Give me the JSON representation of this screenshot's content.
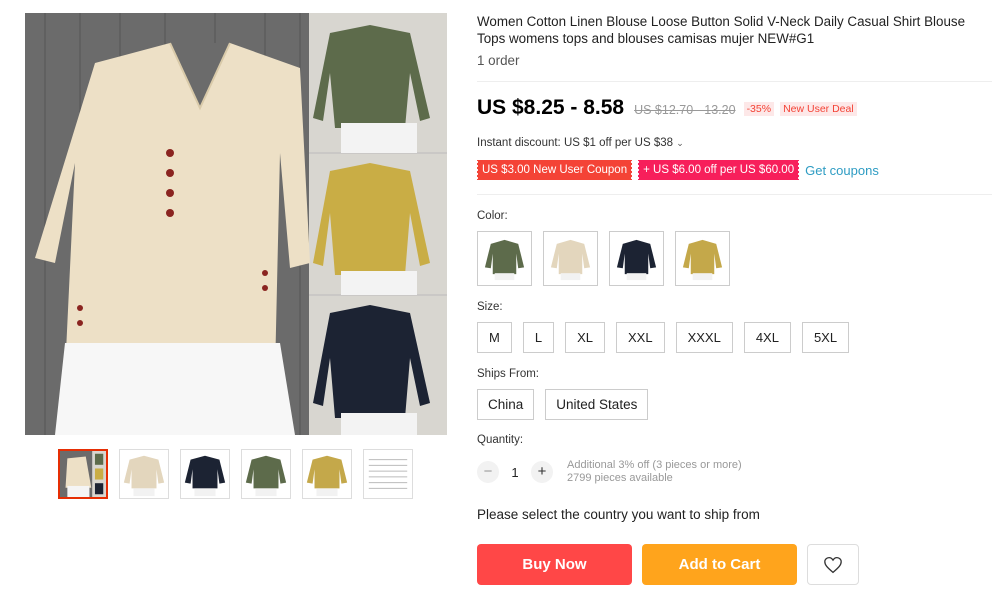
{
  "product": {
    "title": "Women Cotton Linen Blouse Loose Button Solid V-Neck Daily Casual Shirt Blouse Tops womens tops and blouses camisas mujer NEW#G1",
    "orders": "1 order"
  },
  "price": {
    "current": "US $8.25 - 8.58",
    "original": "US $12.70 - 13.20",
    "discount": "-35%",
    "deal_badge": "New User Deal"
  },
  "instant_discount": "Instant discount: US $1 off per US $38",
  "coupons": {
    "coupon_a": "US $3.00 New User Coupon",
    "coupon_b": "+ US $6.00 off per US $60.00",
    "get_link": "Get coupons"
  },
  "color": {
    "label": "Color:",
    "options": [
      {
        "name": "army-green",
        "hex": "#5d6b4b"
      },
      {
        "name": "beige",
        "hex": "#e3d6bd"
      },
      {
        "name": "navy",
        "hex": "#1c2333"
      },
      {
        "name": "yellow",
        "hex": "#c4a84a"
      }
    ]
  },
  "size": {
    "label": "Size:",
    "options": [
      "M",
      "L",
      "XL",
      "XXL",
      "XXXL",
      "4XL",
      "5XL"
    ]
  },
  "ships_from": {
    "label": "Ships From:",
    "options": [
      "China",
      "United States"
    ]
  },
  "quantity": {
    "label": "Quantity:",
    "value": "1",
    "minus": "−",
    "plus": "+",
    "promo": "Additional 3% off (3 pieces or more)",
    "available": "2799 pieces available"
  },
  "ship_message": "Please select the country you want to ship from",
  "actions": {
    "buy_now": "Buy Now",
    "add_to_cart": "Add to Cart",
    "wishlist_icon": "heart-icon"
  },
  "colors": {
    "primary_red": "#ff4747",
    "cart_orange": "#ffa41c",
    "link_blue": "#2e9cc3",
    "thumb_active_border": "#e62e04"
  },
  "gallery": {
    "thumb_count": 6,
    "active_thumb": 1
  }
}
